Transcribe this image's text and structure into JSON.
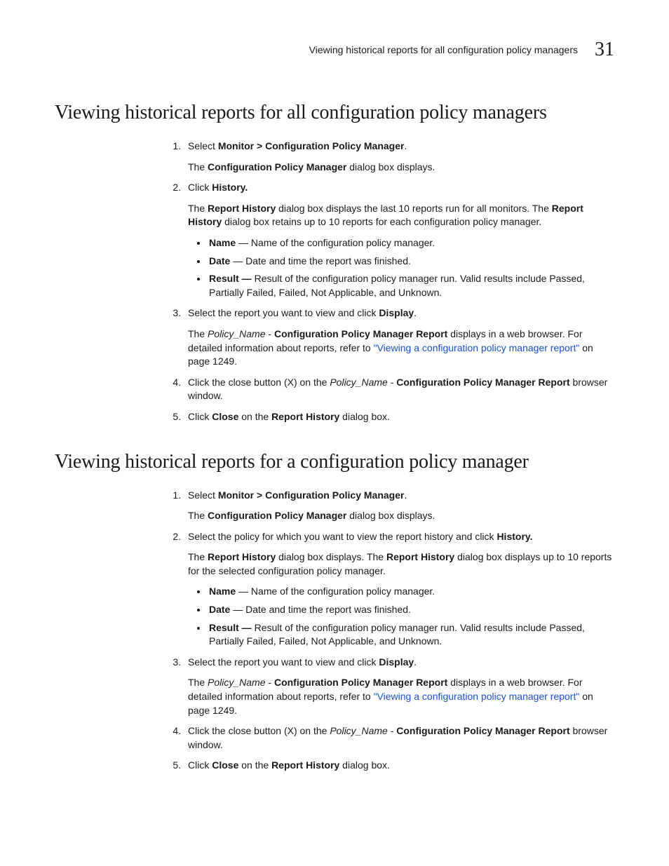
{
  "header": {
    "title": "Viewing historical reports for all configuration policy managers",
    "page": "31"
  },
  "section1": {
    "heading": "Viewing historical reports for all configuration policy managers",
    "step1": {
      "pre": "Select ",
      "bold": "Monitor > Configuration Policy Manager",
      "post": ".",
      "sub_pre": "The ",
      "sub_bold": "Configuration Policy Manager",
      "sub_post": " dialog box displays."
    },
    "step2": {
      "pre": "Click ",
      "bold": "History.",
      "sub_pre": "The ",
      "sub_b1": "Report History",
      "sub_mid": " dialog box displays the last 10 reports run for all monitors. The ",
      "sub_b2": "Report History",
      "sub_post": " dialog box retains up to 10 reports for each configuration policy manager.",
      "bullet1": {
        "bold": "Name",
        "rest": " — Name of the configuration policy manager."
      },
      "bullet2": {
        "bold": "Date",
        "rest": " — Date and time the report was finished."
      },
      "bullet3": {
        "bold": "Result —",
        "rest": " Result of the configuration policy manager run. Valid results include Passed, Partially Failed, Failed, Not Applicable, and Unknown."
      }
    },
    "step3": {
      "pre": "Select the report you want to view and click ",
      "bold": "Display",
      "post": ".",
      "sub_pre": "The ",
      "sub_i": "Policy_Name",
      "sub_dash": " - ",
      "sub_b": "Configuration Policy Manager Report",
      "sub_mid": " displays in a web browser. For detailed information about reports, refer to ",
      "sub_link": "\"Viewing a configuration policy manager report\"",
      "sub_post": " on page 1249."
    },
    "step4": {
      "pre": "Click the close button (X) on the ",
      "i": "Policy_Name",
      "dash": " - ",
      "bold": "Configuration Policy Manager Report",
      "post": " browser window."
    },
    "step5": {
      "pre": "Click ",
      "b1": "Close",
      "mid": " on the ",
      "b2": "Report History",
      "post": " dialog box."
    }
  },
  "section2": {
    "heading": "Viewing historical reports for a configuration policy manager",
    "step1": {
      "pre": "Select ",
      "bold": "Monitor > Configuration Policy Manager",
      "post": ".",
      "sub_pre": "The ",
      "sub_bold": "Configuration Policy Manager",
      "sub_post": " dialog box displays."
    },
    "step2": {
      "pre": "Select the policy for which you want to view the report history and click ",
      "bold": "History.",
      "sub_pre": "The ",
      "sub_b1": "Report History",
      "sub_mid": " dialog box displays. The ",
      "sub_b2": "Report History",
      "sub_post": " dialog box displays up to 10 reports for the selected configuration policy manager.",
      "bullet1": {
        "bold": "Name",
        "rest": " — Name of the configuration policy manager."
      },
      "bullet2": {
        "bold": "Date",
        "rest": " — Date and time the report was finished."
      },
      "bullet3": {
        "bold": "Result —",
        "rest": " Result of the configuration policy manager run. Valid results include Passed, Partially Failed, Failed, Not Applicable, and Unknown."
      }
    },
    "step3": {
      "pre": "Select the report you want to view and click ",
      "bold": "Display",
      "post": ".",
      "sub_pre": "The ",
      "sub_i": "Policy_Name",
      "sub_dash": " - ",
      "sub_b": "Configuration Policy Manager Report",
      "sub_mid": " displays in a web browser. For detailed information about reports, refer to ",
      "sub_link": "\"Viewing a configuration policy manager report\"",
      "sub_post": " on page 1249."
    },
    "step4": {
      "pre": "Click the close button (X) on the ",
      "i": "Policy_Name",
      "dash": " - ",
      "bold": "Configuration Policy Manager Report",
      "post": " browser window."
    },
    "step5": {
      "pre": "Click ",
      "b1": "Close",
      "mid": " on the ",
      "b2": "Report History",
      "post": " dialog box."
    }
  }
}
